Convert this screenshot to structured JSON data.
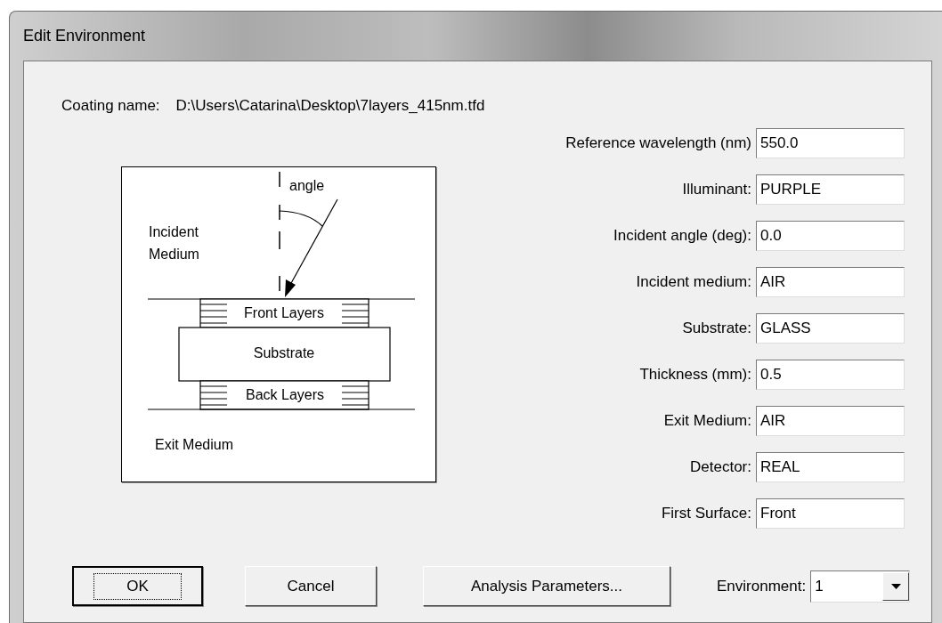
{
  "window": {
    "title": "Edit Environment"
  },
  "coating": {
    "label": "Coating name:",
    "value": "D:\\Users\\Catarina\\Desktop\\7layers_415nm.tfd"
  },
  "diagram": {
    "angle_label": "angle",
    "incident_medium": "Incident Medium",
    "front_layers": "Front Layers",
    "substrate": "Substrate",
    "back_layers": "Back Layers",
    "exit_medium": "Exit Medium"
  },
  "fields": [
    {
      "label": "Reference wavelength (nm)",
      "value": "550.0"
    },
    {
      "label": "Illuminant:",
      "value": "PURPLE"
    },
    {
      "label": "Incident angle (deg):",
      "value": "0.0"
    },
    {
      "label": "Incident medium:",
      "value": "AIR"
    },
    {
      "label": "Substrate:",
      "value": "GLASS"
    },
    {
      "label": "Thickness (mm):",
      "value": "0.5"
    },
    {
      "label": "Exit Medium:",
      "value": "AIR"
    },
    {
      "label": "Detector:",
      "value": "REAL"
    },
    {
      "label": "First Surface:",
      "value": "Front"
    }
  ],
  "buttons": [
    {
      "label": "OK",
      "focused": true
    },
    {
      "label": "Cancel",
      "focused": false
    },
    {
      "label": "Analysis Parameters...",
      "focused": false
    }
  ],
  "environment": {
    "label": "Environment:",
    "value": "1"
  }
}
